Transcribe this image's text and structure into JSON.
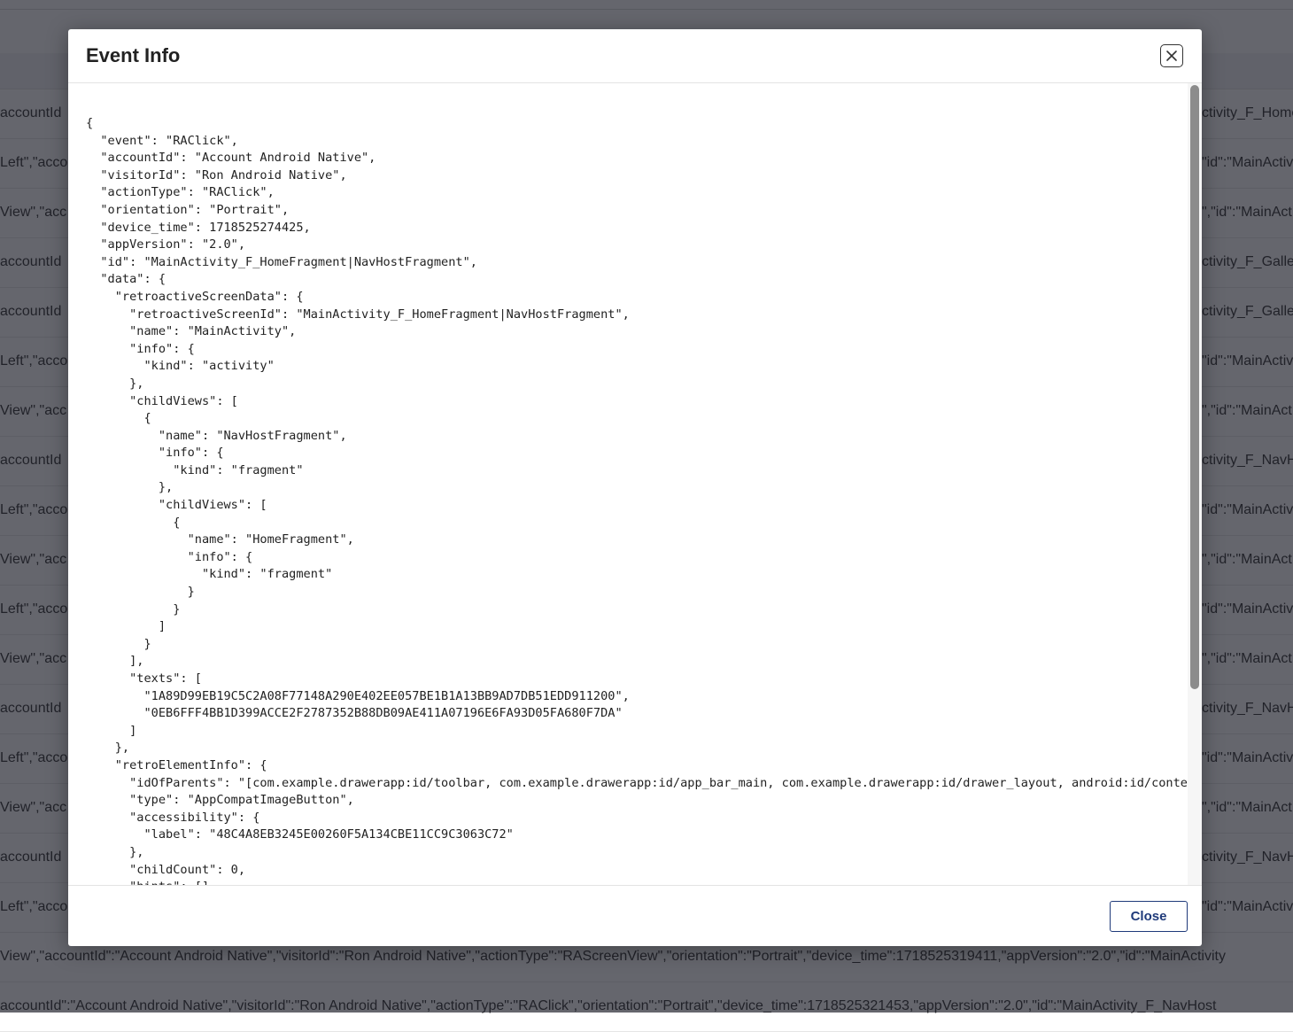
{
  "background": {
    "rows": [
      {
        "left": "accountId",
        "right": "ctivity_F_HomeFr"
      },
      {
        "left": "Left\",\"acco",
        "right": "\"id\":\"MainActiv"
      },
      {
        "left": "View\",\"acc",
        "right": "\",\"id\":\"MainAct"
      },
      {
        "left": "accountId",
        "right": "ctivity_F_Gallery"
      },
      {
        "left": "accountId",
        "right": "ctivity_F_Gallery"
      },
      {
        "left": "Left\",\"acco",
        "right": "\"id\":\"MainActiv"
      },
      {
        "left": "View\",\"acc",
        "right": "\",\"id\":\"MainAct"
      },
      {
        "left": "accountId",
        "right": "ctivity_F_NavHo"
      },
      {
        "left": "Left\",\"acco",
        "right": "\"id\":\"MainActiv"
      },
      {
        "left": "View\",\"acc",
        "right": "\",\"id\":\"MainAct"
      },
      {
        "left": "Left\",\"acco",
        "right": "\"id\":\"MainActiv"
      },
      {
        "left": "View\",\"acc",
        "right": "\",\"id\":\"MainAct"
      },
      {
        "left": "accountId",
        "right": "ctivity_F_NavHo"
      },
      {
        "left": "Left\",\"acco",
        "right": "\"id\":\"MainActiv"
      },
      {
        "left": "View\",\"acc",
        "right": "\",\"id\":\"MainAct"
      },
      {
        "left": "accountId",
        "right": "ctivity_F_NavHo"
      },
      {
        "left": "Left\",\"acco",
        "right": "\"id\":\"MainActiv"
      }
    ],
    "full_rows": [
      "View\",\"accountId\":\"Account Android Native\",\"visitorId\":\"Ron Android Native\",\"actionType\":\"RAScreenView\",\"orientation\":\"Portrait\",\"device_time\":1718525319411,\"appVersion\":\"2.0\",\"id\":\"MainActivity",
      "accountId\":\"Account Android Native\",\"visitorId\":\"Ron Android Native\",\"actionType\":\"RAClick\",\"orientation\":\"Portrait\",\"device_time\":1718525321453,\"appVersion\":\"2.0\",\"id\":\"MainActivity_F_NavHost"
    ]
  },
  "modal": {
    "title": "Event Info",
    "close_button_label": "Close",
    "json_text": "{\n  \"event\": \"RAClick\",\n  \"accountId\": \"Account Android Native\",\n  \"visitorId\": \"Ron Android Native\",\n  \"actionType\": \"RAClick\",\n  \"orientation\": \"Portrait\",\n  \"device_time\": 1718525274425,\n  \"appVersion\": \"2.0\",\n  \"id\": \"MainActivity_F_HomeFragment|NavHostFragment\",\n  \"data\": {\n    \"retroactiveScreenData\": {\n      \"retroactiveScreenId\": \"MainActivity_F_HomeFragment|NavHostFragment\",\n      \"name\": \"MainActivity\",\n      \"info\": {\n        \"kind\": \"activity\"\n      },\n      \"childViews\": [\n        {\n          \"name\": \"NavHostFragment\",\n          \"info\": {\n            \"kind\": \"fragment\"\n          },\n          \"childViews\": [\n            {\n              \"name\": \"HomeFragment\",\n              \"info\": {\n                \"kind\": \"fragment\"\n              }\n            }\n          ]\n        }\n      ],\n      \"texts\": [\n        \"1A89D99EB19C5C2A08F77148A290E402EE057BE1B1A13BB9AD7DB51EDD911200\",\n        \"0EB6FFF4BB1D399ACCE2F2787352B88DB09AE411A07196E6FA93D05FA680F7DA\"\n      ]\n    },\n    \"retroElementInfo\": {\n      \"idOfParents\": \"[com.example.drawerapp:id/toolbar, com.example.drawerapp:id/app_bar_main, com.example.drawerapp:id/drawer_layout, android:id/content]\",\n      \"type\": \"AppCompatImageButton\",\n      \"accessibility\": {\n        \"label\": \"48C4A8EB3245E00260F5A134CBE11CC9C3063C72\"\n      },\n      \"childCount\": 0,\n      \"hints\": []"
  }
}
